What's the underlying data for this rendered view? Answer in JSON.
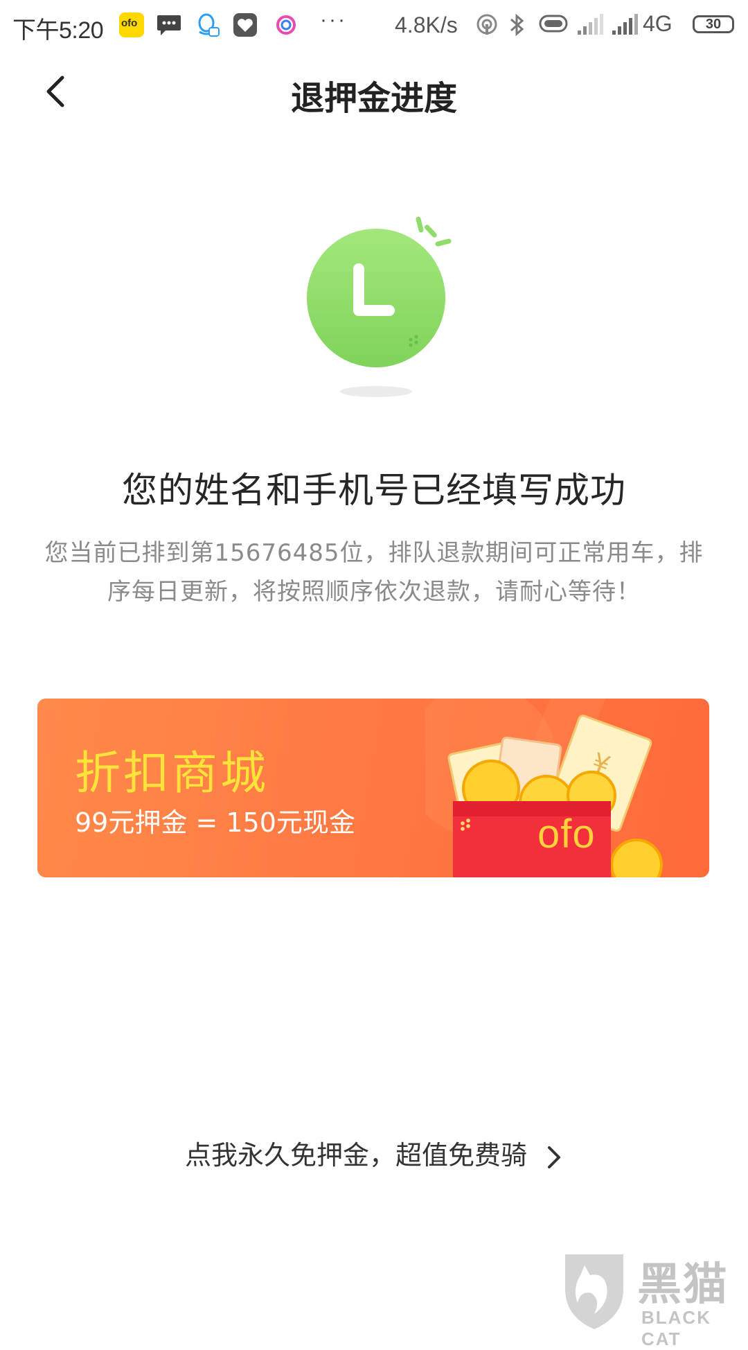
{
  "status_bar": {
    "time": "下午5:20",
    "network_speed": "4.8K/s",
    "network_type": "4G",
    "battery": "30",
    "more": "···",
    "icons": [
      "ofo-app-icon",
      "message-icon",
      "qq-icon",
      "heart-app-icon",
      "color-app-icon",
      "hotspot-icon",
      "bluetooth-icon",
      "vibrate-icon",
      "signal-icon",
      "signal-icon",
      "battery-icon"
    ]
  },
  "nav": {
    "title": "退押金进度",
    "back_icon": "chevron-left-icon"
  },
  "illustration": {
    "icon": "clock-icon",
    "color": "#8fdc6a"
  },
  "message": {
    "headline": "您的姓名和手机号已经填写成功",
    "description": "您当前已排到第15676485位，排队退款期间可正常用车，排序每日更新，将按照顺序依次退款，请耐心等待！"
  },
  "banner": {
    "title": "折扣商城",
    "subtitle": "99元押金 = 150元现金",
    "brand": "ofo",
    "title_color": "#ffe23a",
    "background_color": "#ff7a43"
  },
  "promo": {
    "label": "点我永久免押金，超值免费骑",
    "icon": "chevron-right-icon"
  },
  "watermark": {
    "name_cn": "黑猫",
    "name_en": "BLACK CAT"
  }
}
